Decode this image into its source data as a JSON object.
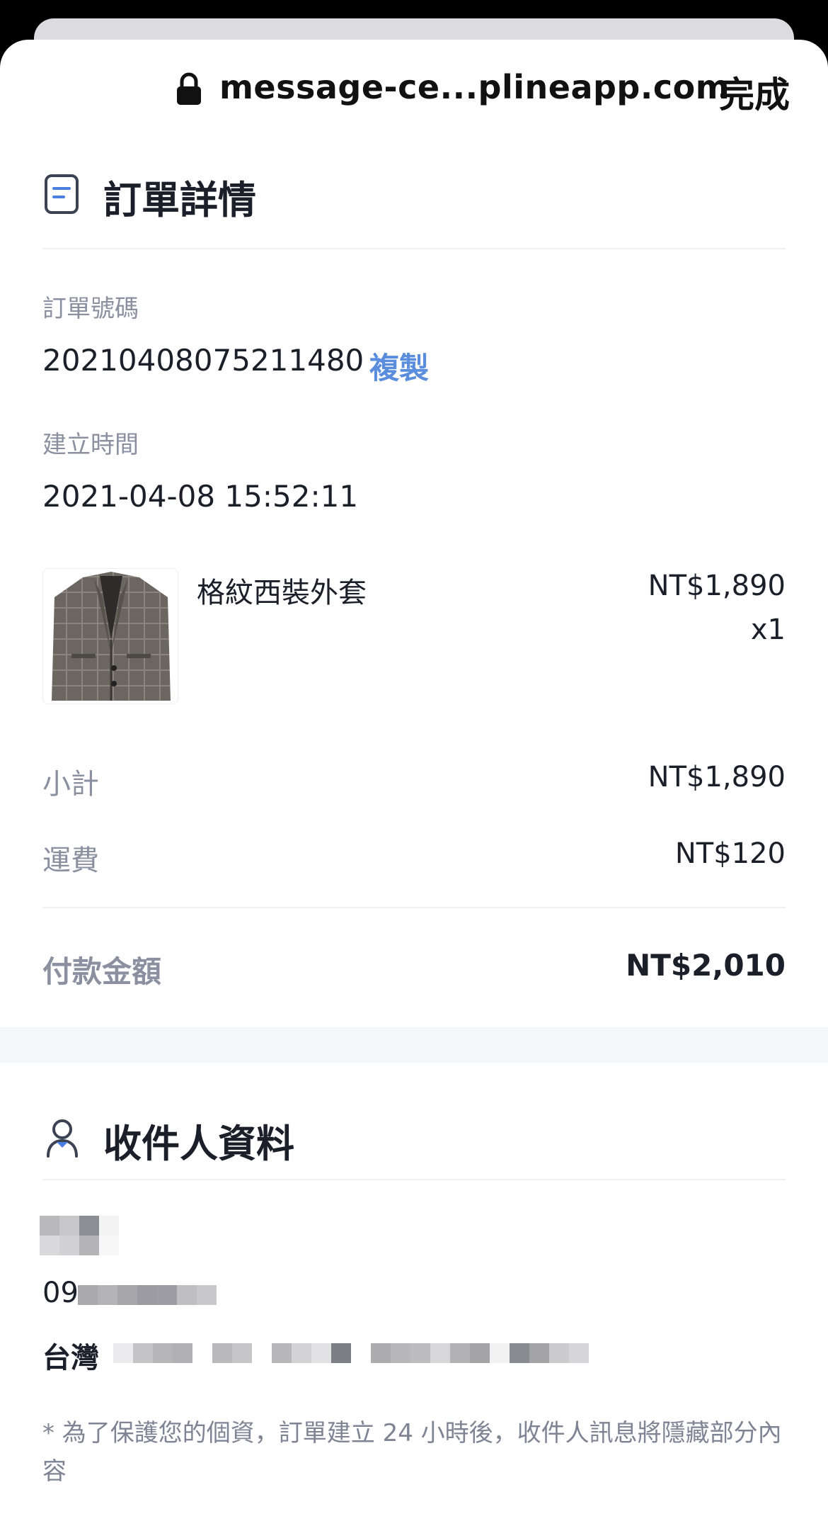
{
  "browser": {
    "url": "message-ce...plineapp.com",
    "done_label": "完成"
  },
  "order": {
    "section_title": "訂單詳情",
    "number_label": "訂單號碼",
    "number_value": "20210408075211480",
    "copy_label": "複製",
    "created_label": "建立時間",
    "created_value": "2021-04-08 15:52:11",
    "item": {
      "name": "格紋西裝外套",
      "price": "NT$1,890",
      "quantity": "x1"
    },
    "subtotal_label": "小計",
    "subtotal_value": "NT$1,890",
    "shipping_label": "運費",
    "shipping_value": "NT$120",
    "total_label": "付款金額",
    "total_value": "NT$2,010"
  },
  "recipient": {
    "section_title": "收件人資料",
    "phone_prefix": "09",
    "country": "台灣",
    "privacy_note": "* 為了保護您的個資，訂單建立 24 小時後，收件人訊息將隱藏部分內容"
  },
  "colors": {
    "accent": "#5b8ddd",
    "text_primary": "#1b1f29",
    "text_secondary": "#8a90a0"
  }
}
